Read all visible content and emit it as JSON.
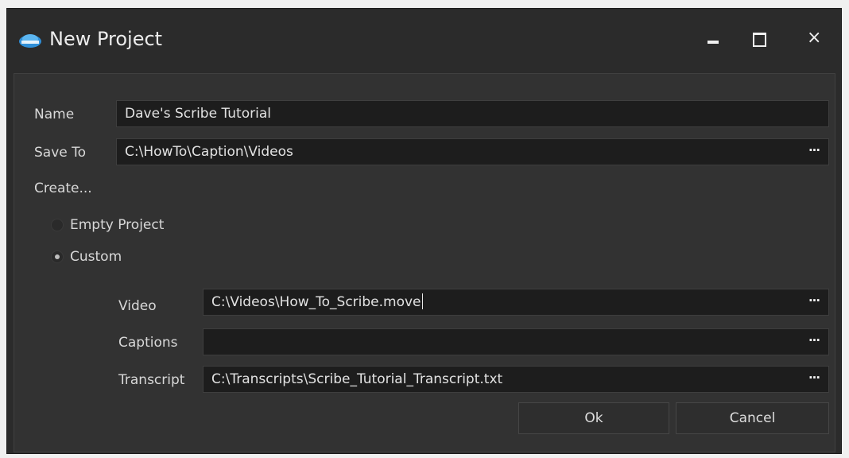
{
  "window": {
    "title": "New Project",
    "app_icon": "caption-app-icon",
    "controls": {
      "minimize": "minimize-icon",
      "maximize": "maximize-icon",
      "close": "×"
    }
  },
  "form": {
    "name_label": "Name",
    "name_value": "Dave's Scribe Tutorial",
    "save_to_label": "Save To",
    "save_to_value": "C:\\HowTo\\Caption\\Videos",
    "browse_label": "···",
    "create_label": "Create...",
    "options": [
      {
        "label": "Empty Project",
        "selected": false
      },
      {
        "label": "Custom",
        "selected": true
      }
    ],
    "custom": {
      "video_label": "Video",
      "video_value": "C:\\Videos\\How_To_Scribe.move",
      "captions_label": "Captions",
      "captions_value": "",
      "transcript_label": "Transcript",
      "transcript_value": "C:\\Transcripts\\Scribe_Tutorial_Transcript.txt"
    }
  },
  "buttons": {
    "ok": "Ok",
    "cancel": "Cancel"
  },
  "colors": {
    "background": "#2b2b2b",
    "panel": "#323232",
    "field": "#1d1d1d",
    "text": "#dcdcdc"
  }
}
